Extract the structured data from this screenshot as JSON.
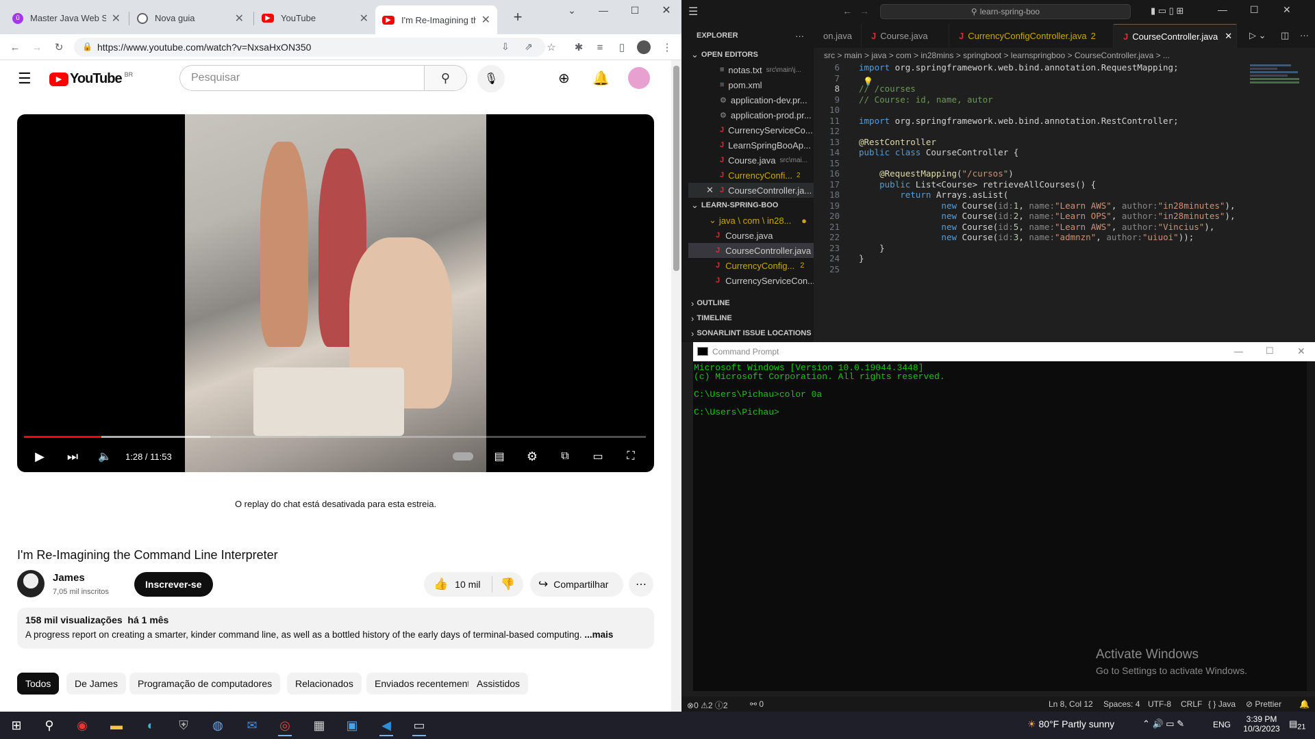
{
  "chrome": {
    "tabs": [
      {
        "label": "Master Java Web Ser",
        "icon": "udemy-icon",
        "color": "#a435f0"
      },
      {
        "label": "Nova guia",
        "icon": "chrome-icon",
        "color": "#5f6368"
      },
      {
        "label": "YouTube",
        "icon": "youtube-icon",
        "color": "#ff0000"
      },
      {
        "label": "I'm Re-Imagining the",
        "icon": "youtube-icon",
        "color": "#ff0000"
      }
    ],
    "new_tab": "+",
    "url": "https://www.youtube.com/watch?v=NxsaHxON350"
  },
  "youtube": {
    "logo": "YouTube",
    "region": "BR",
    "search_placeholder": "Pesquisar",
    "video_time": "1:28 / 11:53",
    "video_progress": 0.124,
    "chat_replay_msg": "O replay do chat está desativada para esta estreia.",
    "video_title": "I'm Re-Imagining the Command Line Interpreter",
    "channel_name": "James",
    "subscribers": "7,05 mil inscritos",
    "subscribe_label": "Inscrever-se",
    "likes": "10 mil",
    "share_label": "Compartilhar",
    "views": "158 mil visualizações",
    "date": "há 1 mês",
    "description": "A progress report on creating a smarter, kinder command line, as well as a bottled history of the early days of terminal-based computing.",
    "more_label": "...mais",
    "chips": [
      "Todos",
      "De James",
      "Programação de computadores",
      "Relacionados",
      "Enviados recentemente",
      "Assistidos"
    ]
  },
  "vscode": {
    "search": "learn-spring-boo",
    "explorer_title": "EXPLORER",
    "open_editors_label": "OPEN EDITORS",
    "open_editors": [
      {
        "name": "notas.txt",
        "path": "src\\main\\j...",
        "type": "txt"
      },
      {
        "name": "pom.xml",
        "path": "",
        "type": "xml"
      },
      {
        "name": "application-dev.pr...",
        "path": "",
        "type": "prop"
      },
      {
        "name": "application-prod.pr...",
        "path": "",
        "type": "prop"
      },
      {
        "name": "CurrencyServiceCo...",
        "path": "",
        "type": "java"
      },
      {
        "name": "LearnSpringBooAp...",
        "path": "",
        "type": "java"
      },
      {
        "name": "Course.java",
        "path": "src\\mai...",
        "type": "java"
      },
      {
        "name": "CurrencyConfi...",
        "path": "2",
        "type": "java-warn"
      },
      {
        "name": "CourseController.ja...",
        "path": "",
        "type": "java-active"
      }
    ],
    "project_label": "LEARN-SPRING-BOO",
    "project_folder": "java \\ com \\ in28...",
    "project_files": [
      {
        "name": "Course.java",
        "badge": ""
      },
      {
        "name": "CourseController.java",
        "badge": ""
      },
      {
        "name": "CurrencyConfig...",
        "badge": "2"
      },
      {
        "name": "CurrencyServiceCon...",
        "badge": ""
      }
    ],
    "outline_label": "OUTLINE",
    "timeline_label": "TIMELINE",
    "sonarlint_label": "SONARLINT ISSUE LOCATIONS",
    "tabs": [
      {
        "label": "on.java",
        "badge": ""
      },
      {
        "label": "Course.java",
        "badge": ""
      },
      {
        "label": "CurrencyConfigController.java",
        "badge": "2"
      },
      {
        "label": "CourseController.java",
        "badge": ""
      }
    ],
    "breadcrumb": "src  >  main  >  java  >  com  >  in28mins  >  springboot  >  learnspringboo  >  CourseController.java  >  ...",
    "code": [
      {
        "n": "6",
        "t": "import org.springframework.web.bind.annotation.RequestMapping;"
      },
      {
        "n": "7",
        "t": ""
      },
      {
        "n": "8",
        "t": "// /courses"
      },
      {
        "n": "9",
        "t": "// Course: id, name, autor"
      },
      {
        "n": "10",
        "t": ""
      },
      {
        "n": "11",
        "t": "import org.springframework.web.bind.annotation.RestController;"
      },
      {
        "n": "12",
        "t": ""
      },
      {
        "n": "13",
        "t": "@RestController"
      },
      {
        "n": "14",
        "t": "public class CourseController {"
      },
      {
        "n": "15",
        "t": ""
      },
      {
        "n": "16",
        "t": "    @RequestMapping(\"/cursos\")"
      },
      {
        "n": "17",
        "t": "    public List<Course> retrieveAllCourses() {"
      },
      {
        "n": "18",
        "t": "        return Arrays.asList("
      },
      {
        "n": "19",
        "t": "                new Course(id:1, name:\"Learn AWS\", author:\"in28minutes\"),"
      },
      {
        "n": "20",
        "t": "                new Course(id:2, name:\"Learn OPS\", author:\"in28minutes\"),"
      },
      {
        "n": "21",
        "t": "                new Course(id:5, name:\"Learn AWS\", author:\"Vincius\"),"
      },
      {
        "n": "22",
        "t": "                new Course(id:3, name:\"admnzn\", author:\"uiuoi\"));"
      },
      {
        "n": "23",
        "t": "    }"
      },
      {
        "n": "24",
        "t": "}"
      },
      {
        "n": "25",
        "t": ""
      }
    ],
    "status": {
      "errors": "0",
      "warnings": "2",
      "info": "2",
      "ports": "0",
      "position": "Ln 8, Col 12",
      "spaces": "Spaces: 4",
      "encoding": "UTF-8",
      "eol": "CRLF",
      "language": "Java",
      "formatter": "Prettier"
    }
  },
  "cmd": {
    "title": "Command Prompt",
    "lines": [
      "Microsoft Windows [Version 10.0.19044.3448]",
      "(c) Microsoft Corporation. All rights reserved.",
      "",
      "C:\\Users\\Pichau>color 0a",
      "",
      "C:\\Users\\Pichau>"
    ],
    "text_color": "#16c60c"
  },
  "watermark": {
    "title": "Activate Windows",
    "subtitle": "Go to Settings to activate Windows."
  },
  "taskbar": {
    "weather": "80°F  Partly sunny",
    "language": "ENG",
    "time": "3:39 PM",
    "date": "10/3/2023",
    "notifications": "21"
  }
}
